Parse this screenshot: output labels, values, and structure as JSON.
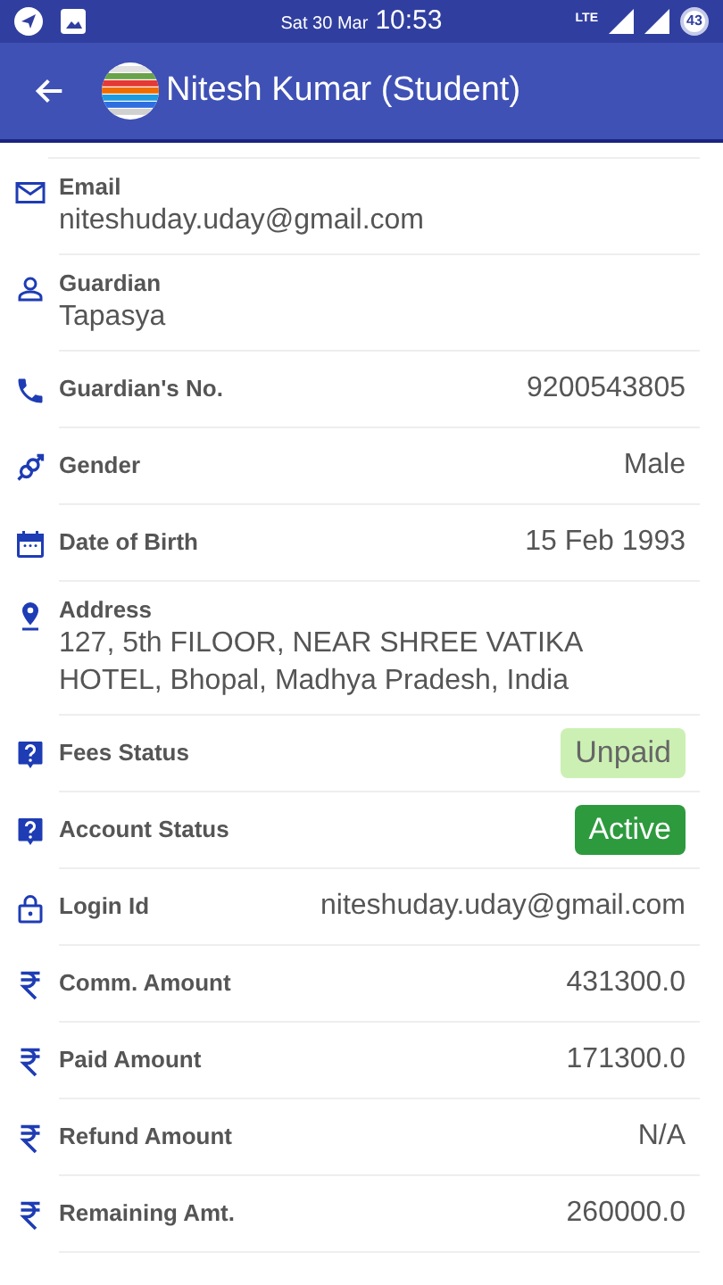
{
  "status_bar": {
    "date": "Sat 30 Mar",
    "time": "10:53",
    "network": "LTE",
    "battery": "43"
  },
  "app_bar": {
    "title": "Nitesh Kumar (Student)"
  },
  "fields": [
    {
      "kind": "stacked",
      "label": "Email",
      "value": "niteshuday.uday@gmail.com"
    },
    {
      "kind": "stacked",
      "label": "Guardian",
      "value": "Tapasya"
    },
    {
      "kind": "inline",
      "label": "Guardian's No.",
      "value": "9200543805"
    },
    {
      "kind": "inline",
      "label": "Gender",
      "value": "Male"
    },
    {
      "kind": "inline",
      "label": "Date of Birth",
      "value": "15 Feb 1993"
    },
    {
      "kind": "stacked",
      "label": "Address",
      "value": "127, 5th FILOOR, NEAR SHREE VATIKA HOTEL, Bhopal, Madhya Pradesh, India"
    },
    {
      "kind": "badge",
      "label": "Fees Status",
      "value": "Unpaid",
      "color": "#ccf0b4"
    },
    {
      "kind": "badge",
      "label": "Account Status",
      "value": "Active",
      "color": "#2e9a3e"
    },
    {
      "kind": "inline",
      "label": "Login Id",
      "value": "niteshuday.uday@gmail.com"
    },
    {
      "kind": "inline",
      "label": "Comm. Amount",
      "value": "431300.0"
    },
    {
      "kind": "inline",
      "label": "Paid Amount",
      "value": "171300.0"
    },
    {
      "kind": "inline",
      "label": "Refund Amount",
      "value": "N/A"
    },
    {
      "kind": "inline",
      "label": "Remaining Amt.",
      "value": "260000.0"
    }
  ]
}
